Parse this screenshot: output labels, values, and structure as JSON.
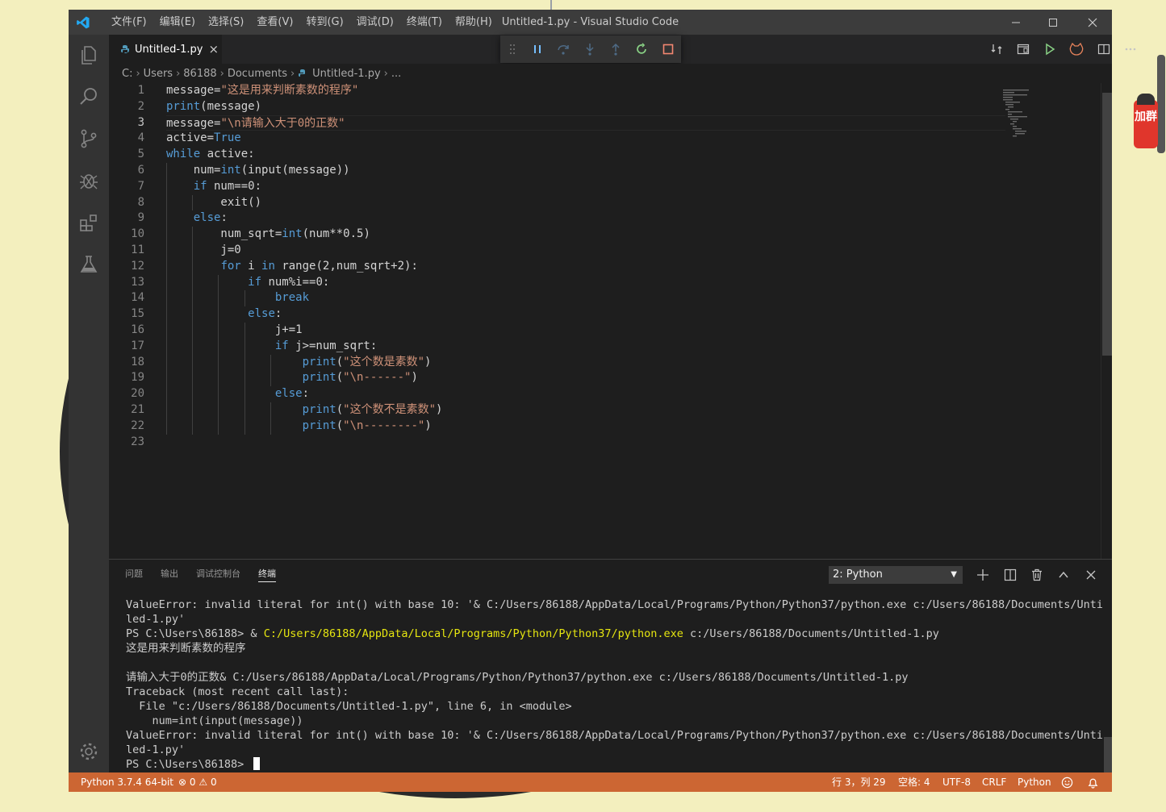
{
  "window": {
    "title": "Untitled-1.py - Visual Studio Code",
    "menu": [
      "文件(F)",
      "编辑(E)",
      "选择(S)",
      "查看(V)",
      "转到(G)",
      "调试(D)",
      "终端(T)",
      "帮助(H)"
    ]
  },
  "tab": {
    "label": "Untitled-1.py",
    "close": "×"
  },
  "breadcrumb": {
    "drive": "C:",
    "p1": "Users",
    "p2": "86188",
    "p3": "Documents",
    "file": "Untitled-1.py",
    "more": "..."
  },
  "editor": {
    "line_numbers": [
      "1",
      "2",
      "3",
      "4",
      "5",
      "6",
      "7",
      "8",
      "9",
      "10",
      "11",
      "12",
      "13",
      "14",
      "15",
      "16",
      "17",
      "18",
      "19",
      "20",
      "21",
      "22",
      "23"
    ],
    "active_line": "3",
    "lines": [
      [
        {
          "t": "message="
        },
        {
          "t": "\"这是用来判断素数的程序\"",
          "c": "s"
        }
      ],
      [
        {
          "t": "print",
          "c": "k"
        },
        {
          "t": "(message)"
        }
      ],
      [
        {
          "t": "message="
        },
        {
          "t": "\"\\n请输入大于0的正数\"",
          "c": "s"
        }
      ],
      [
        {
          "t": "active="
        },
        {
          "t": "True",
          "c": "k"
        }
      ],
      [
        {
          "t": "while",
          "c": "k"
        },
        {
          "t": " active:"
        }
      ],
      [
        {
          "t": "    num="
        },
        {
          "t": "int",
          "c": "k"
        },
        {
          "t": "(input(message))"
        }
      ],
      [
        {
          "t": "    "
        },
        {
          "t": "if",
          "c": "k"
        },
        {
          "t": " num==0:"
        }
      ],
      [
        {
          "t": "        exit()"
        }
      ],
      [
        {
          "t": "    "
        },
        {
          "t": "else",
          "c": "k"
        },
        {
          "t": ":"
        }
      ],
      [
        {
          "t": "        num_sqrt="
        },
        {
          "t": "int",
          "c": "k"
        },
        {
          "t": "(num**0.5)"
        }
      ],
      [
        {
          "t": "        j=0"
        }
      ],
      [
        {
          "t": "        "
        },
        {
          "t": "for",
          "c": "k"
        },
        {
          "t": " i "
        },
        {
          "t": "in",
          "c": "k"
        },
        {
          "t": " range(2,num_sqrt+2):"
        }
      ],
      [
        {
          "t": "            "
        },
        {
          "t": "if",
          "c": "k"
        },
        {
          "t": " num%i==0:"
        }
      ],
      [
        {
          "t": "                "
        },
        {
          "t": "break",
          "c": "k"
        }
      ],
      [
        {
          "t": "            "
        },
        {
          "t": "else",
          "c": "k"
        },
        {
          "t": ":"
        }
      ],
      [
        {
          "t": "                j+=1"
        }
      ],
      [
        {
          "t": "                "
        },
        {
          "t": "if",
          "c": "k"
        },
        {
          "t": " j>=num_sqrt:"
        }
      ],
      [
        {
          "t": "                    "
        },
        {
          "t": "print",
          "c": "k"
        },
        {
          "t": "("
        },
        {
          "t": "\"这个数是素数\"",
          "c": "s"
        },
        {
          "t": ")"
        }
      ],
      [
        {
          "t": "                    "
        },
        {
          "t": "print",
          "c": "k"
        },
        {
          "t": "("
        },
        {
          "t": "\"\\n------\"",
          "c": "s"
        },
        {
          "t": ")"
        }
      ],
      [
        {
          "t": "                "
        },
        {
          "t": "else",
          "c": "k"
        },
        {
          "t": ":"
        }
      ],
      [
        {
          "t": "                    "
        },
        {
          "t": "print",
          "c": "k"
        },
        {
          "t": "("
        },
        {
          "t": "\"这个数不是素数\"",
          "c": "s"
        },
        {
          "t": ")"
        }
      ],
      [
        {
          "t": "                    "
        },
        {
          "t": "print",
          "c": "k"
        },
        {
          "t": "("
        },
        {
          "t": "\"\\n--------\"",
          "c": "s"
        },
        {
          "t": ")"
        }
      ],
      [
        {
          "t": ""
        }
      ]
    ],
    "indent_levels": [
      0,
      0,
      0,
      0,
      0,
      1,
      1,
      2,
      1,
      2,
      2,
      2,
      3,
      4,
      3,
      4,
      4,
      5,
      5,
      4,
      5,
      5,
      0
    ]
  },
  "panel": {
    "tabs": [
      "问题",
      "输出",
      "调试控制台",
      "终端"
    ],
    "active_tab": "终端",
    "terminal_select": "2: Python",
    "terminal_lines": [
      [
        {
          "t": "ValueError: invalid literal for int() with base 10: '& C:/Users/86188/AppData/Local/Programs/Python/Python37/python.exe c:/Users/86188/Documents/Untit"
        }
      ],
      [
        {
          "t": "led-1.py'"
        }
      ],
      [
        {
          "t": "PS C:\\Users\\86188> & "
        },
        {
          "t": "C:/Users/86188/AppData/Local/Programs/Python/Python37/python.exe",
          "c": "ty"
        },
        {
          "t": " c:/Users/86188/Documents/Untitled-1.py"
        }
      ],
      [
        {
          "t": "这是用来判断素数的程序"
        }
      ],
      [
        {
          "t": ""
        }
      ],
      [
        {
          "t": "请输入大于0的正数& C:/Users/86188/AppData/Local/Programs/Python/Python37/python.exe c:/Users/86188/Documents/Untitled-1.py"
        }
      ],
      [
        {
          "t": "Traceback (most recent call last):"
        }
      ],
      [
        {
          "t": "  File \"c:/Users/86188/Documents/Untitled-1.py\", line 6, in <module>"
        }
      ],
      [
        {
          "t": "    num=int(input(message))"
        }
      ],
      [
        {
          "t": "ValueError: invalid literal for int() with base 10: '& C:/Users/86188/AppData/Local/Programs/Python/Python37/python.exe c:/Users/86188/Documents/Untit"
        }
      ],
      [
        {
          "t": "led-1.py'"
        }
      ],
      [
        {
          "t": "PS C:\\Users\\86188> "
        }
      ]
    ]
  },
  "status": {
    "interpreter": "Python 3.7.4 64-bit",
    "errors": "0",
    "warnings": "0",
    "position": "行 3，列 29",
    "spaces": "空格: 4",
    "encoding": "UTF-8",
    "eol": "CRLF",
    "language": "Python"
  },
  "desktop_widget": {
    "text": "加群"
  },
  "colors": {
    "statusbar": "#cc6633",
    "titlebar": "#3c3c3c",
    "activitybar": "#333333",
    "editor": "#1e1e1e",
    "keyword": "#569cd6",
    "string": "#ce9178"
  }
}
